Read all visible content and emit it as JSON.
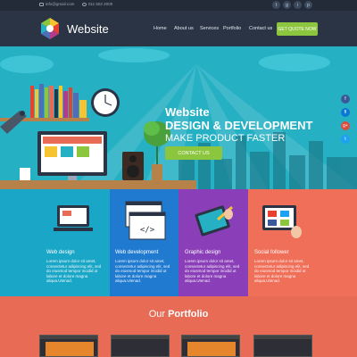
{
  "topbar": {
    "email": "info@gmail.com",
    "phone": "011 502 2000",
    "socials": [
      "t",
      "g",
      "i",
      "p"
    ]
  },
  "header": {
    "brand": "Website",
    "nav": [
      "Home",
      "About us",
      "Services",
      "Portfolio",
      "Contact us"
    ],
    "cta": "GET QUOTE NOW"
  },
  "hero": {
    "line1": "Website",
    "line2": "DESIGN & DEVELOPMENT",
    "line3": "MAKE PRODUCT FASTER",
    "button": "CONTACT US",
    "side_socials": [
      "f",
      "fl",
      "g+",
      "t"
    ]
  },
  "services": [
    {
      "title": "Web design",
      "desc": "Lorem ipsum dolor sit amet, consectetur adipiscing elit, sed do eiusmod tempor incidid ut labore et dolore magna aliqua.Utenad.",
      "color": "#1aa6c6"
    },
    {
      "title": "Web development",
      "desc": "Lorem ipsum dolor sit amet, consectetur adipiscing elit, sed do eiusmod tempor incidid ut labore et dolore magna aliqua.Utenad.",
      "color": "#1f7ad0"
    },
    {
      "title": "Graphic design",
      "desc": "Lorem ipsum dolor sit amet, consectetur adipiscing elit, sed do eiusmod tempor incidid ut labore et dolore magna aliqua.Utenad.",
      "color": "#8a3fb8"
    },
    {
      "title": "Social follower",
      "desc": "Lorem ipsum dolor sit amet, consectetur adipiscing elit, sed do eiusmod tempor incidid ut labore et dolore magna aliqua.Utenad.",
      "color": "#ef6f59"
    }
  ],
  "portfolio": {
    "title_prefix": "Our",
    "title_bold": "Portfolio"
  },
  "colors": {
    "accent_green": "#8cc63f",
    "hero_bg": "#25b0c4",
    "header_bg": "#2b3444",
    "portfolio_bg": "#e86b56"
  }
}
